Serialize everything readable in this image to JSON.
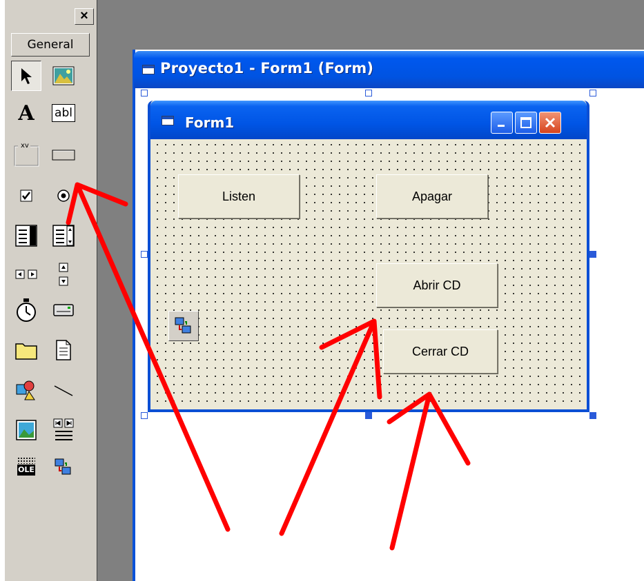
{
  "toolbox": {
    "close_label": "×",
    "tab_label": "General",
    "tools": [
      {
        "name": "pointer-tool",
        "icon": "pointer-icon"
      },
      {
        "name": "picturebox-tool",
        "icon": "picturebox-icon"
      },
      {
        "name": "label-tool",
        "icon": "label-icon",
        "glyph": "A"
      },
      {
        "name": "textbox-tool",
        "icon": "textbox-icon",
        "glyph": "abl"
      },
      {
        "name": "frame-tool",
        "icon": "frame-icon",
        "glyph": "xv"
      },
      {
        "name": "commandbutton-tool",
        "icon": "commandbutton-icon"
      },
      {
        "name": "checkbox-tool",
        "icon": "checkbox-icon"
      },
      {
        "name": "optionbutton-tool",
        "icon": "optionbutton-icon"
      },
      {
        "name": "combobox-tool",
        "icon": "combobox-icon"
      },
      {
        "name": "listbox-tool",
        "icon": "listbox-icon"
      },
      {
        "name": "hscrollbar-tool",
        "icon": "hscrollbar-icon"
      },
      {
        "name": "vscrollbar-tool",
        "icon": "vscrollbar-icon"
      },
      {
        "name": "timer-tool",
        "icon": "timer-icon"
      },
      {
        "name": "drivelistbox-tool",
        "icon": "drivelistbox-icon"
      },
      {
        "name": "dirlistbox-tool",
        "icon": "dirlistbox-icon"
      },
      {
        "name": "filelistbox-tool",
        "icon": "filelistbox-icon"
      },
      {
        "name": "shape-tool",
        "icon": "shape-icon"
      },
      {
        "name": "line-tool",
        "icon": "line-icon"
      },
      {
        "name": "image-tool",
        "icon": "image-icon"
      },
      {
        "name": "data-tool",
        "icon": "data-icon"
      },
      {
        "name": "ole-tool",
        "icon": "ole-icon",
        "glyph": "OLE"
      },
      {
        "name": "winsock-tool",
        "icon": "winsock-icon"
      }
    ]
  },
  "designer": {
    "title": "Proyecto1 - Form1 (Form)"
  },
  "form": {
    "title": "Form1",
    "buttons": {
      "listen": "Listen",
      "apagar": "Apagar",
      "abrir_cd": "Abrir CD",
      "cerrar_cd": "Cerrar CD"
    }
  },
  "colors": {
    "xp_blue": "#0055e5",
    "close_red": "#d6431d",
    "annotation_red": "#ff0000",
    "form_background": "#ece9d8"
  }
}
